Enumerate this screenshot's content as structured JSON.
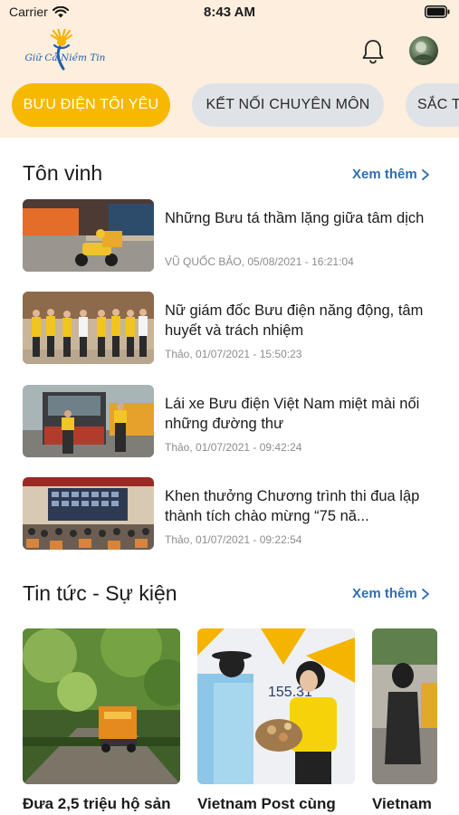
{
  "status_bar": {
    "carrier": "Carrier",
    "time": "8:43 AM"
  },
  "header": {
    "logo_text": "Giữ Cả Niềm Tin",
    "notification_icon": "bell-icon",
    "avatar_icon": "user-avatar"
  },
  "tabs": [
    {
      "label": "BƯU ĐIỆN TÔI YÊU",
      "active": true
    },
    {
      "label": "KẾT NỐI CHUYÊN MÔN",
      "active": false
    },
    {
      "label": "SẮC T",
      "active": false
    }
  ],
  "honor": {
    "title": "Tôn vinh",
    "more": "Xem thêm",
    "items": [
      {
        "title": "Những Bưu tá thầm lặng giữa tâm dịch",
        "meta": "VŨ QUỐC BẢO, 05/08/2021 - 16:21:04"
      },
      {
        "title": "Nữ giám đốc Bưu điện năng động, tâm huyết và trách nhiệm",
        "meta": "Thảo, 01/07/2021 - 15:50:23"
      },
      {
        "title": "Lái xe Bưu điện Việt Nam miệt mài nối những đường thư",
        "meta": "Thảo, 01/07/2021 - 09:42:24"
      },
      {
        "title": "Khen thưởng Chương trình thi đua lập thành tích chào mừng “75 nă...",
        "meta": "Thảo, 01/07/2021 - 09:22:54"
      }
    ]
  },
  "news": {
    "title": "Tin tức - Sự kiện",
    "more": "Xem thêm",
    "cards": [
      {
        "title": "Đưa 2,5 triệu hộ sản"
      },
      {
        "title": "Vietnam Post cùng"
      },
      {
        "title": "Vietnam"
      }
    ]
  },
  "colors": {
    "accent": "#f7b800",
    "header_bg": "#fdeedd",
    "link": "#2d6fb5",
    "tab_inactive": "#dfe3e8"
  }
}
